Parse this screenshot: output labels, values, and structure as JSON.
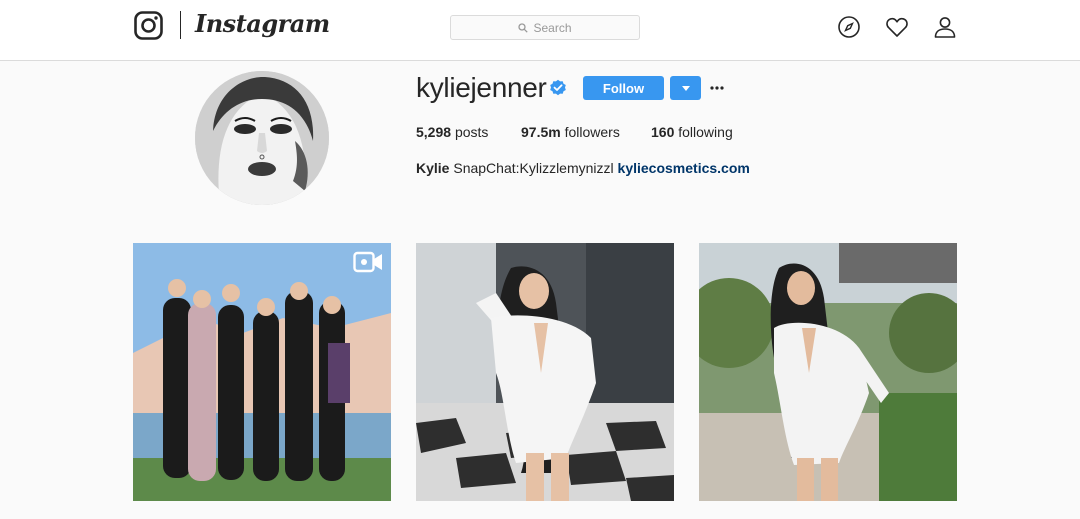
{
  "app": {
    "wordmark": "Instagram"
  },
  "topbar": {
    "search_placeholder": "Search",
    "icons": [
      "compass-icon",
      "heart-icon",
      "profile-icon"
    ]
  },
  "profile": {
    "username": "kyliejenner",
    "verified": true,
    "follow_label": "Follow",
    "stats": {
      "posts_count": "5,298",
      "posts_label": "posts",
      "followers_count": "97.5m",
      "followers_label": "followers",
      "following_count": "160",
      "following_label": "following"
    },
    "bio": {
      "name": "Kylie",
      "text": "SnapChat:Kylizzlemynizzl",
      "link": "kyliecosmetics.com"
    }
  },
  "posts": [
    {
      "type": "video",
      "icon": "video-icon"
    },
    {
      "type": "photo"
    },
    {
      "type": "photo"
    }
  ],
  "colors": {
    "accent": "#3897f0",
    "background": "#fafafa",
    "text": "#262626",
    "link": "#003569"
  }
}
